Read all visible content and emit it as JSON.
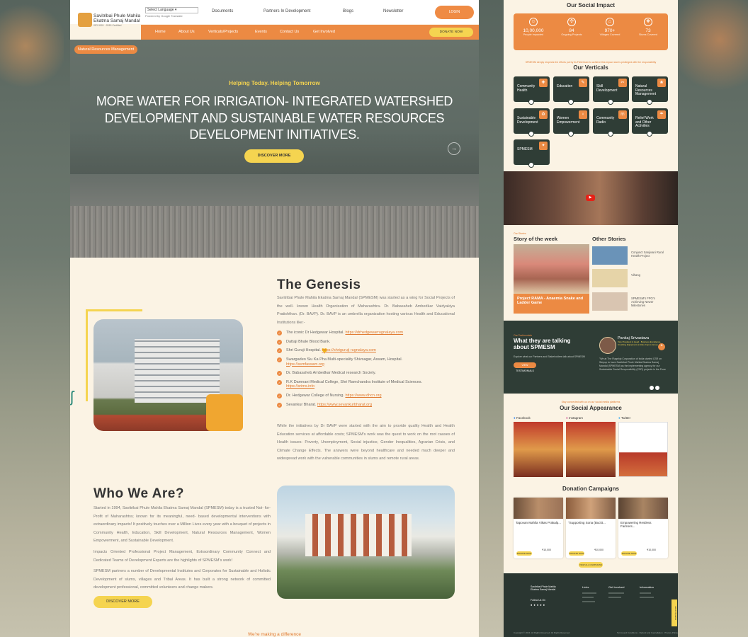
{
  "header": {
    "logo_line1": "Savitribai Phule Mahila",
    "logo_line2": "Ekatma Samaj Mandal",
    "logo_sub": "ISO 9001 : 2015 Certified",
    "language_select": "Select Language",
    "powered_by": "Powered by Google Translate",
    "top_nav": [
      "Documents",
      "Partners In Development",
      "Blogs",
      "Newsletter"
    ],
    "login_label": "LOGIN",
    "main_nav": [
      "Home",
      "About Us",
      "Verticals/Projects",
      "Events",
      "Contact Us",
      "Get Involved"
    ],
    "donate_label": "DONATE NOW"
  },
  "hero": {
    "tag": "Natural Resources Management",
    "subtitle": "Helping Today. Helping Tomorrow",
    "title": "MORE WATER FOR IRRIGATION- INTEGRATED WATERSHED DEVELOPMENT AND SUSTAINABLE WATER RESOURCES DEVELOPMENT INITIATIVES.",
    "button": "DISCOVER MORE",
    "arrow": "→"
  },
  "genesis": {
    "title": "The Genesis",
    "intro": "Savitribai Phule Mahila Ekatma Samaj Mandal (SPMESM) was started as a wing for Social Projects of the well- known Health Organization of Maharashtra- Dr. Babasaheb Ambedkar Vaidyakiya Pratishthan. (Dr. BAVP). Dr. BAVP is an umbrella organization hosting various Health and Educational Institutions like:-",
    "items": [
      {
        "text": "The iconic Dr Hedgewar Hospital.",
        "link": "https://drhedgewarrugnalaya.com"
      },
      {
        "text": "Dattaji Bhale Blood Bank.",
        "link": ""
      },
      {
        "text": "Shri Guruji Hospital.",
        "link": "https://shriguruji rugnalaya.com"
      },
      {
        "text": "Swargadeo Siu Ka Pha Multi-speciality Shivsagar, Assam, Hospital.",
        "link": "https://ssmfassam.org"
      },
      {
        "text": "Dr. Babasaheb Ambedkar Medical research Society.",
        "link": ""
      },
      {
        "text": "R.K Damnani Medical College, Shri Ramchandra Institute of Medical Sciences.",
        "link": "https://srims.info"
      },
      {
        "text": "Dr. Hedgewar College of Nursing.",
        "link": "https://www.dhcn.org"
      },
      {
        "text": "Sevankur Bharat.",
        "link": "https://www.sevankurbharat.org"
      }
    ],
    "closing": "While the initiatives by Dr BAVP were started with the aim to provide quality Health and Health Education services at affordable costs; SPMESM's work was the quest to work on the root causes of Health issues- Poverty, Unemployment, Social injustice, Gender Inequalities, Agrarian Crisis, and Climate Change Effects. The answers were beyond healthcare and needed much deeper and widespread work with the vulnerable communities in slums and remote rural areas."
  },
  "who": {
    "title": "Who We Are?",
    "p1": "Started in 1994, Savitribai Phule Mahila Ekatma Samaj Mandal (SPMESM) today is a trusted Not- for- Profit of Maharashtra; known for its meaningful, need- based developmental interventions with extraordinary impacts! It positively touches over a Million Lives every year with a bouquet of projects in Community Health, Education, Skill Development, Natural Resources Management, Women Empowerment, and Sustainable Development.",
    "p2": "Impacts Oriented Professional Project Management, Extraordinary Community Connect and Dedicated Teams of Development Experts are the highlights of SPMESM's work!",
    "p3": "SPMESM partners a number of Developmental Institutes and Corporates for Sustainable and Holistic Development of slums, villages and Tribal Areas. It has built a strong network of committed development professional, committed volunteers and change makers.",
    "button": "DISCOVER MORE",
    "making": "We're making a difference"
  },
  "impact": {
    "title": "Our Social Impact",
    "stats": [
      {
        "icon": "people-icon",
        "glyph": "☺",
        "value": "10,00,000",
        "label": "People Impacted"
      },
      {
        "icon": "project-icon",
        "glyph": "✣",
        "value": "84",
        "label": "Ongoing Projects"
      },
      {
        "icon": "village-icon",
        "glyph": "⌂",
        "value": "970+",
        "label": "Villages Covered"
      },
      {
        "icon": "cluster-icon",
        "glyph": "❖",
        "value": "73",
        "label": "Slums Covered"
      }
    ],
    "note": "SPMESM deeply respects the efforts put by its Field team to achieve this impact and is privileged with the responsibility"
  },
  "verticals": {
    "title": "Our Verticals",
    "items": [
      "Community Health",
      "Education",
      "Skill Development",
      "Natural Resources Management",
      "Sustainable Development",
      "Women Empowerment",
      "Community Radio",
      "Relief Work and Other Activities",
      "SPMESM"
    ]
  },
  "stories": {
    "kicker": "Our Stories",
    "week_title": "Story of the week",
    "week_caption": "Project RAMA - Anaemia Snake and Ladder Game",
    "other_title": "Other Stories",
    "others": [
      "Conjunct Sanjivani Rural Health Project",
      "Vihang",
      "SPMESM's FPO's Achieving Newer Milestones"
    ]
  },
  "talk": {
    "kicker": "Our Testimonials",
    "title": "What they are talking about SPMESM",
    "sub": "Explore what our Partners and Stakeholders talk about SPMESM",
    "button": "VIEW TESTIMONIALS",
    "person": "Pankaj Srivastava",
    "role": "Vice President & Head - Business Excellence, Crushing Equipment at Atlas Copco Group",
    "quote": "\"We at The Flagship Corporation of India started CSR on Stepup to have Savitribai Phule Mahila Ekatma Samaj Mandal (SPMESM) as the implementing agency for our Sustainable Social Responsibility (CSR) projects in the Pune"
  },
  "social": {
    "kicker": "Stay connected with us on our social media platforms",
    "title": "Our Social Appearance",
    "channels": [
      "Facebook",
      "Instagram",
      "Twitter"
    ]
  },
  "donation": {
    "title": "Donation Campaigns",
    "cards": [
      {
        "title": "Tapovan Mahila Vikas Prakalp...",
        "button": "DONATE NOW",
        "amount": "₹10,000"
      },
      {
        "title": "\"Supporting Sona (Buckt...",
        "button": "DONATE NOW",
        "amount": "₹10,000"
      },
      {
        "title": "Empowering Restless Farmers...",
        "button": "DONATE NOW",
        "amount": "₹10,000"
      }
    ],
    "view_all": "VIEW ALL CAMPAIGNS"
  },
  "footer": {
    "org": "Savitribai Phule Mahila Ekatma Samaj Mandal",
    "follow": "Follow Us On",
    "cols": [
      "Links",
      "Get Involved",
      "Information"
    ],
    "copyright": "Copyright © 2024. All Rights Reserved. All Rights Reserved.",
    "policy": "Terms and Conditions · Refund and Cancellation · Privacy Policy",
    "side_tab": "Latest Updates"
  },
  "colors": {
    "orange": "#ec8a43",
    "yellow": "#f5d450",
    "dark": "#2f3d36",
    "cream": "#fbf3e4"
  }
}
